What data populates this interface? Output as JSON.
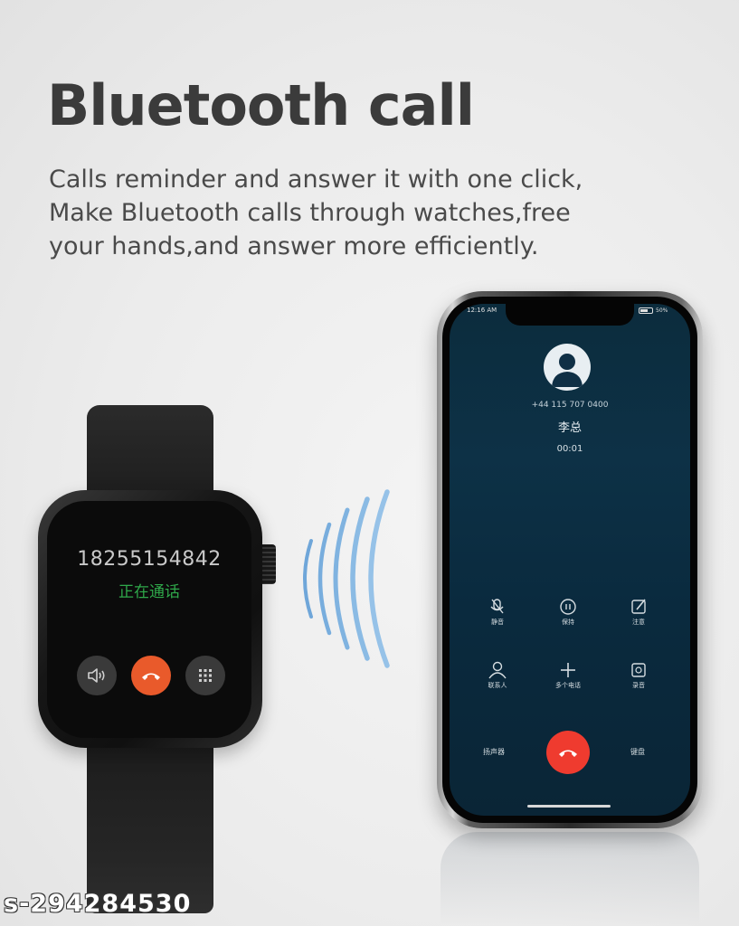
{
  "header": {
    "title": "Bluetooth call",
    "description_lines": [
      "Calls reminder and answer it with one click,",
      "Make Bluetooth calls through watches,free",
      "your hands,and answer more efficiently."
    ]
  },
  "watch": {
    "number": "18255154842",
    "status": "正在通话",
    "buttons": [
      "speaker-icon",
      "hang-up-icon",
      "keypad-icon"
    ],
    "hangup_color": "#e95a2b"
  },
  "phone": {
    "status_time": "12:16 AM",
    "battery": "50%",
    "caller_number": "+44 115 707 0400",
    "caller_name": "李总",
    "call_timer": "00:01",
    "controls": [
      {
        "icon": "mute-icon",
        "label": "静音"
      },
      {
        "icon": "hold-icon",
        "label": "保持"
      },
      {
        "icon": "note-icon",
        "label": "注意"
      },
      {
        "icon": "contacts-icon",
        "label": "联系人"
      },
      {
        "icon": "add-call-icon",
        "label": "多个电话"
      },
      {
        "icon": "record-icon",
        "label": "录音"
      }
    ],
    "speaker_label": "扬声器",
    "keypad_label": "键盘",
    "hangup_color": "#ef3b2f",
    "background": "#0c2c3d"
  },
  "watermark": "s-294284530"
}
